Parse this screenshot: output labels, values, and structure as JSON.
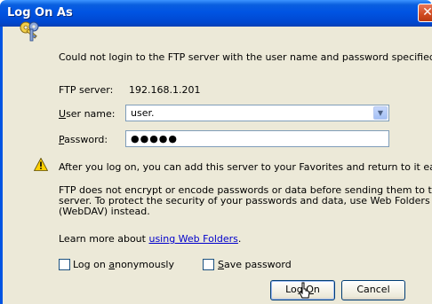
{
  "window": {
    "title": "Log On As",
    "close_glyph": "✕"
  },
  "message": "Could not login to the FTP server with the user name and password specified.",
  "ftp_server": {
    "label": "FTP server:",
    "value": "192.168.1.201"
  },
  "user_name": {
    "label_first": "U",
    "label_rest": "ser name:",
    "value": "user."
  },
  "password": {
    "label_first": "P",
    "label_rest": "assword:",
    "value": "●●●●●"
  },
  "info_text": "After you log on, you can add this server to your Favorites and return to it easily.",
  "warning": {
    "line1": "FTP does not encrypt or encode passwords or data before sending them to the",
    "line2": "server.  To protect the security of your passwords and data, use Web Folders",
    "line3": "(WebDAV) instead."
  },
  "learn_more": {
    "prefix": "Learn more about ",
    "link": "using Web Folders",
    "suffix": "."
  },
  "anonymous_checkbox": {
    "label_pre": "Log on ",
    "label_acc": "a",
    "label_post": "nonymously",
    "checked": false
  },
  "save_password_checkbox": {
    "label_acc": "S",
    "label_post": "ave password",
    "checked": false
  },
  "buttons": {
    "logon_pre": "Log ",
    "logon_acc": "O",
    "logon_post": "n",
    "cancel": "Cancel"
  },
  "icons": [
    "keys-icon",
    "warning-icon",
    "close-icon",
    "dropdown-arrow-icon",
    "mouse-cursor-icon"
  ]
}
